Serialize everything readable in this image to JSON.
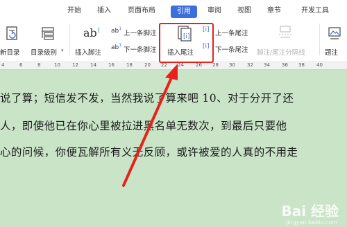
{
  "ribbon": {
    "tabs": [
      {
        "label": "开始"
      },
      {
        "label": "插入"
      },
      {
        "label": "页面布局"
      },
      {
        "label": "引用",
        "active": true
      },
      {
        "label": "审阅"
      },
      {
        "label": "视图"
      },
      {
        "label": "章节"
      },
      {
        "label": "开发工具"
      }
    ]
  },
  "toolbar": {
    "update_toc_label": "新目录",
    "toc_level_label": "目录级别",
    "insert_footnote_label": "插入脚注",
    "prev_footnote_label": "上一条脚注",
    "next_footnote_label": "下一条脚注",
    "insert_endnote_label": "插入尾注",
    "prev_endnote_label": "上一条尾注",
    "next_endnote_label": "下一条尾注",
    "separator_label": "脚注/尾注分隔线",
    "caption_label": "题注"
  },
  "ruler": {
    "numbers": [
      "4",
      "6",
      "8",
      "10",
      "12",
      "14",
      "16",
      "18",
      "20",
      "22",
      "24",
      "26",
      "28",
      "30",
      "32",
      "34",
      "36",
      "38",
      "40"
    ]
  },
  "document": {
    "lines": [
      "说了算；短信发不发，当然我说了算来吧 10、对于分开了还",
      "人，即使他已在你心里被拉进黑名单无数次，到最后只要他",
      "心的问候，你便瓦解所有义无反顾，或许被爱的人真的不用走"
    ]
  },
  "watermark": {
    "brand": "Bai 经验",
    "url": "jingyan.baidu.com"
  },
  "colors": {
    "accent": "#3c6edc",
    "highlight": "#e8211a",
    "doc_bg": "#c9e4c7"
  }
}
